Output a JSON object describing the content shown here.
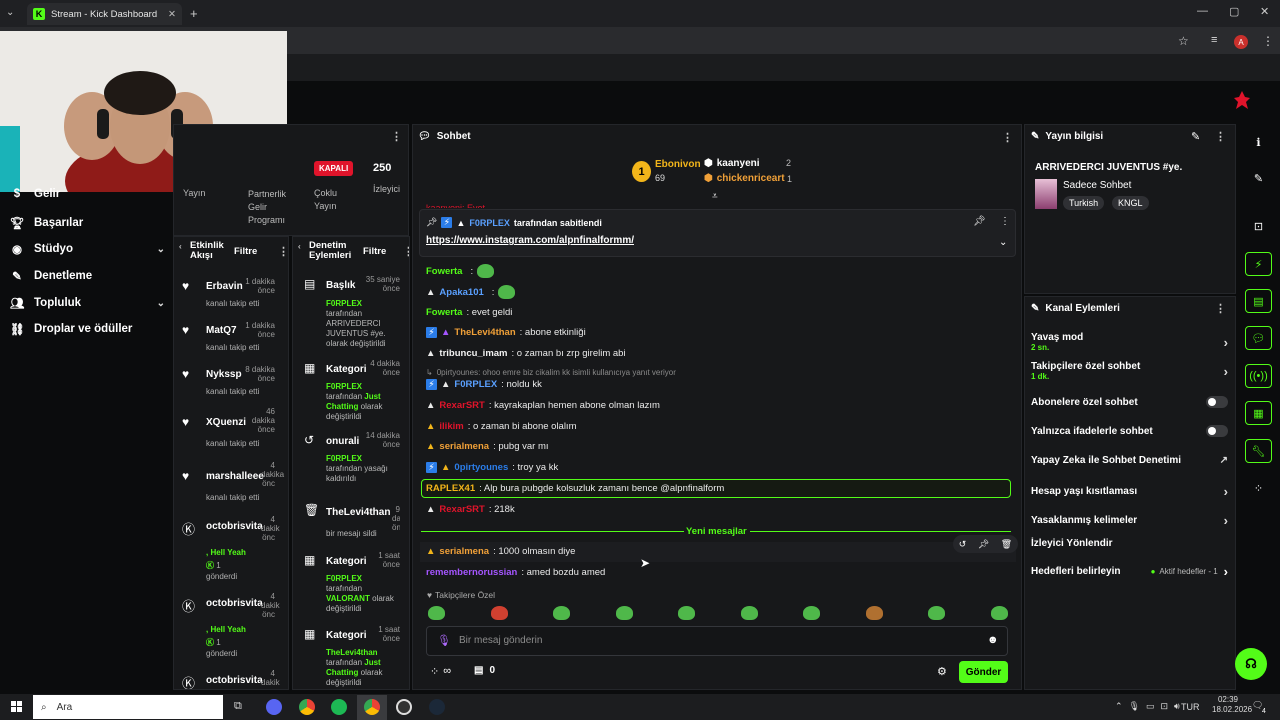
{
  "browser": {
    "tab_title": "Stream - Kick Dashboard",
    "tab_close": "✕",
    "new_tab": "+",
    "win_min": "—",
    "win_max": "▢",
    "win_close": "✕",
    "profile_initial": "A"
  },
  "sidebar": {
    "items": [
      {
        "label": "Gelir"
      },
      {
        "label": "Başarılar"
      },
      {
        "label": "Stüdyo"
      },
      {
        "label": "Denetleme"
      },
      {
        "label": "Topluluk"
      },
      {
        "label": "Droplar ve ödüller"
      }
    ]
  },
  "stats": {
    "yayin": "Yayın",
    "partner": "Partnerlik Gelir Programı",
    "status_badge": "KAPALI",
    "multi_label": "Çoklu Yayın",
    "viewers_count": "250",
    "viewers_label": "İzleyici"
  },
  "activity_feed": {
    "title": "Etkinlik Akışı",
    "filter": "Filtre",
    "items": [
      {
        "name": "Erbavin",
        "time": "1 dakika önce",
        "sub": "kanalı takip etti"
      },
      {
        "name": "MatQ7",
        "time": "1 dakika önce",
        "sub": "kanalı takip etti"
      },
      {
        "name": "Nykssp",
        "time": "8 dakika önce",
        "sub": "kanalı takip etti"
      },
      {
        "name": "XQuenzi",
        "time": "46 dakika önce",
        "sub": "kanalı takip etti"
      },
      {
        "name": "marshalleee",
        "time": "4 dakika önc",
        "sub": "kanalı takip etti"
      },
      {
        "name": "octobrisvita",
        "time": "4 dakik önc",
        "line1": ", Hell Yeah",
        "line2": "1",
        "line3": "gönderdi"
      },
      {
        "name": "octobrisvita",
        "time": "4 dakik önc",
        "line1": ", Hell Yeah",
        "line2": "1",
        "line3": "gönderdi"
      },
      {
        "name": "octobrisvita",
        "time": "4 dakik"
      }
    ]
  },
  "mod_actions": {
    "title": "Denetim Eylemleri",
    "filter": "Filtre",
    "items": [
      {
        "title": "Başlık",
        "time": "35 saniye önce",
        "user": "F0RPLEX",
        "desc": "tarafından ARRIVEDERCI JUVENTUS #ye. olarak değiştirildi"
      },
      {
        "title": "Kategori",
        "time": "4 dakika önce",
        "user": "F0RPLEX",
        "desc_a": "tarafından",
        "hl": "Just Chatting",
        "desc_b": "olarak değiştirildi"
      },
      {
        "title": "onurali",
        "time": "14 dakika önce",
        "user": "F0RPLEX",
        "desc": "tarafından yasağı kaldırıldı"
      },
      {
        "title": "TheLevi4than",
        "time": "9 dakika önce",
        "desc": "bir mesajı sildi"
      },
      {
        "title": "Kategori",
        "time": "1 saat önce",
        "user": "F0RPLEX",
        "desc_a": "tarafından",
        "hl": "VALORANT",
        "desc_b": "olarak değiştirildi"
      },
      {
        "title": "Kategori",
        "time": "1 saat önce",
        "user": "TheLevi4than",
        "desc_a": "tarafından",
        "hl": "Just Chatting",
        "desc_b": "olarak değiştirildi"
      }
    ]
  },
  "chat": {
    "title": "Sohbet",
    "top1_rank": "1",
    "top1_name": "Ebonivon",
    "top1_count": "69",
    "top2_name": "kaanyeni",
    "top2_count": "2",
    "top3_name": "chickenriceart",
    "top3_count": "1",
    "partial_msg": "kaanyeni: Evet",
    "pinned_by_user": "F0RPLEX",
    "pinned_by_suffix": "tarafından sabitlendi",
    "pinned_link": "https://www.instagram.com/alpnfinalformm/",
    "messages": [
      {
        "user": "Fowerta",
        "text": ""
      },
      {
        "user": "Apaka101",
        "text": ""
      },
      {
        "user": "Fowerta",
        "text": ": evet geldi"
      },
      {
        "user": "TheLevi4than",
        "text": ": abone etkinliği"
      },
      {
        "user": "tribuncu_imam",
        "text": ": o zaman bı zrp girelim abi"
      },
      {
        "user": "",
        "text": "0pirtyounes: ohoo emre biz cikalim kk isimli kullanıcıya yanıt veriyor"
      },
      {
        "user": "F0RPLEX",
        "text": ": noldu kk"
      },
      {
        "user": "RexarSRT",
        "text": ": kayrakaplan hemen abone olman lazım"
      },
      {
        "user": "ilikim",
        "text": ": o zaman bi abone olalım"
      },
      {
        "user": "serialmena",
        "text": ": pubg var mı"
      },
      {
        "user": "0pirtyounes",
        "text": ": troy ya kk"
      },
      {
        "user": "RAPLEX41",
        "text": ": Alp bura pubgde kolsuzluk zamanı bence @alpnfinalform"
      },
      {
        "user": "RexarSRT",
        "text": ": 218k"
      },
      {
        "user": "serialmena",
        "text": ": 1000 olmasın diye"
      },
      {
        "user": "remembernorussian",
        "text": ": amed bozdu amed"
      }
    ],
    "new_messages": "Yeni mesajlar",
    "followers_only": "Takipçilere Özel",
    "input_placeholder": "Bir mesaj gönderin",
    "infinity": "∞",
    "queue_count": "0",
    "send": "Gönder"
  },
  "stream_info": {
    "title": "Yayın bilgisi",
    "stream_title": "ARRIVEDERCI JUVENTUS #ye.",
    "category": "Sadece Sohbet",
    "tag1": "Turkish",
    "tag2": "KNGL"
  },
  "channel_actions": {
    "title": "Kanal Eylemleri",
    "slow_mode": "Yavaş mod",
    "slow_mode_value": "2 sn.",
    "followers_chat": "Takipçilere özel sohbet",
    "followers_chat_value": "1 dk.",
    "subscribers_chat": "Abonelere özel sohbet",
    "emotes_only": "Yalnızca ifadelerle sohbet",
    "ai_moderation": "Yapay Zeka ile Sohbet Denetimi",
    "account_age": "Hesap yaşı kısıtlaması",
    "banned_words": "Yasaklanmış kelimeler",
    "redirect_viewers": "İzleyici Yönlendir",
    "set_goals": "Hedefleri belirleyin",
    "active_goals": "Aktif hedefler - 1"
  },
  "taskbar": {
    "search": "Ara",
    "lang": "TUR",
    "time": "02:39",
    "date": "18.02.2026",
    "notif": "4"
  },
  "colors": {
    "accent": "#53fc18",
    "badge_red": "#e0142b"
  }
}
